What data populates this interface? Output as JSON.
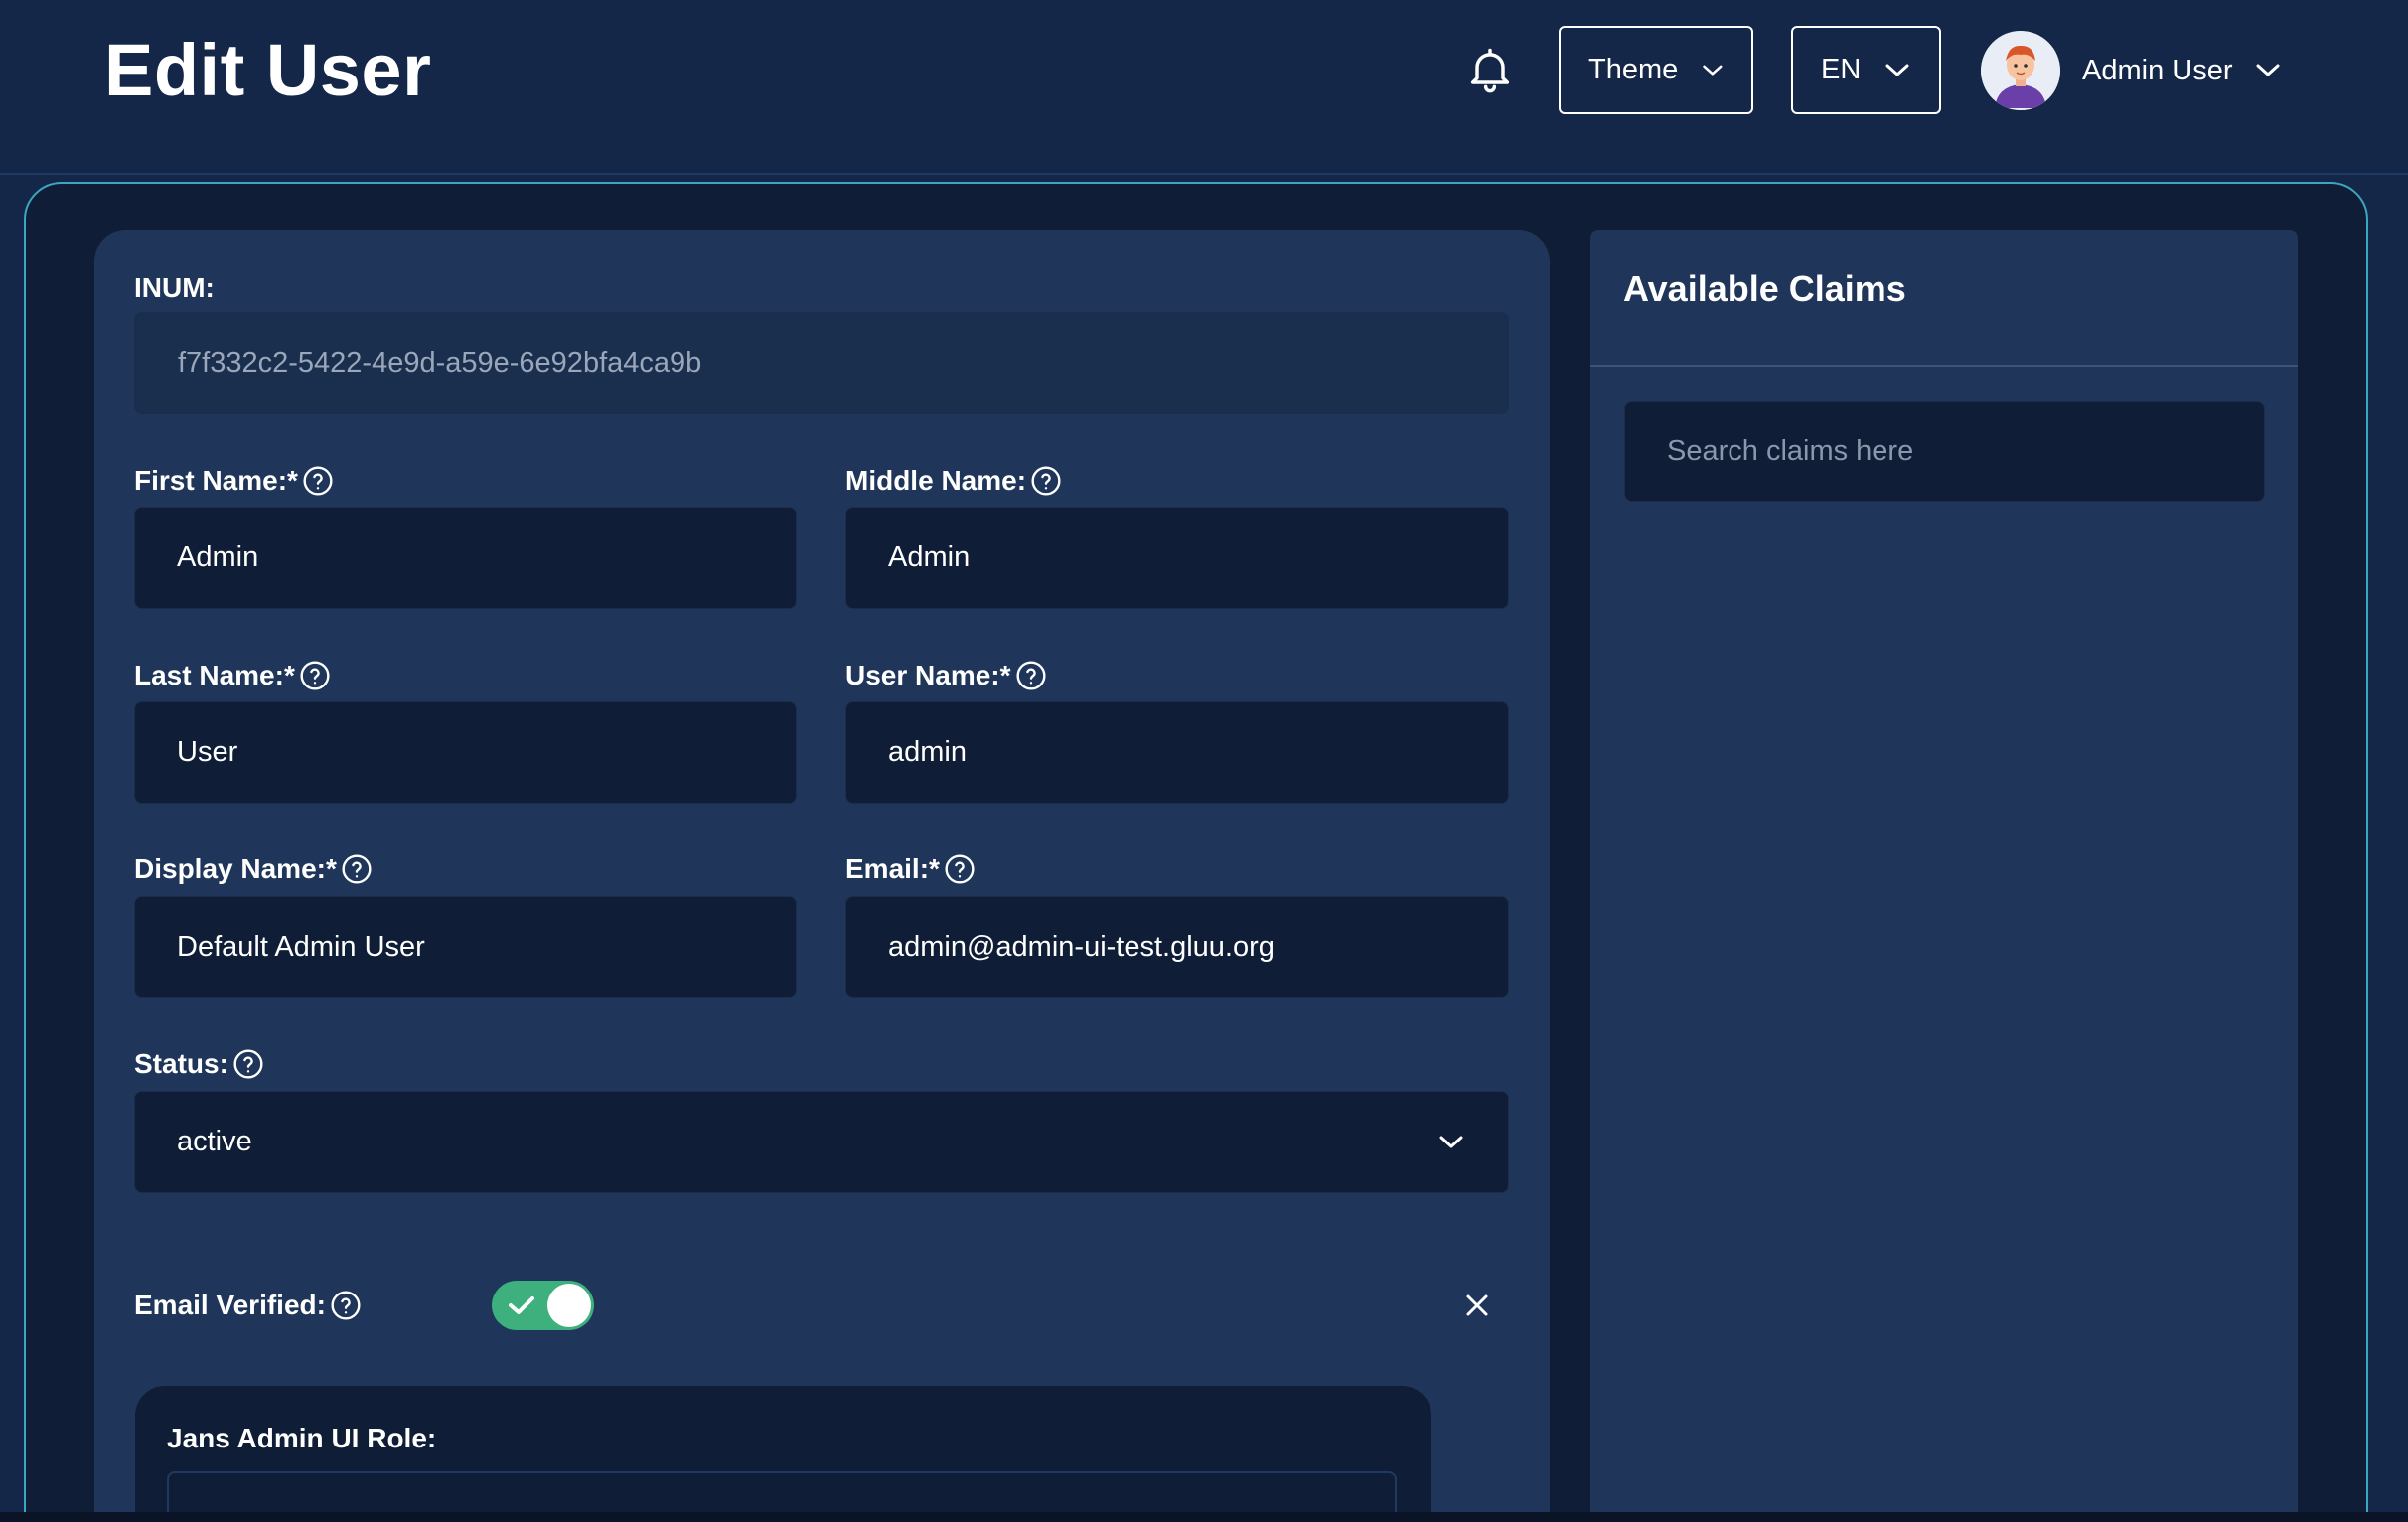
{
  "header": {
    "title": "Edit User",
    "theme_label": "Theme",
    "language_label": "EN",
    "user_name": "Admin User"
  },
  "form": {
    "inum": {
      "label": "INUM:",
      "value": "f7f332c2-5422-4e9d-a59e-6e92bfa4ca9b"
    },
    "first_name": {
      "label": "First Name:*",
      "value": "Admin"
    },
    "middle_name": {
      "label": "Middle Name:",
      "value": "Admin"
    },
    "last_name": {
      "label": "Last Name:*",
      "value": "User"
    },
    "user_name": {
      "label": "User Name:*",
      "value": "admin"
    },
    "display_name": {
      "label": "Display Name:*",
      "value": "Default Admin User"
    },
    "email": {
      "label": "Email:*",
      "value": "admin@admin-ui-test.gluu.org"
    },
    "status": {
      "label": "Status:",
      "value": "active"
    },
    "email_verified": {
      "label": "Email Verified:",
      "checked": true
    },
    "role": {
      "label": "Jans Admin UI Role:"
    }
  },
  "claims": {
    "title": "Available Claims",
    "search_placeholder": "Search claims here"
  },
  "icons": {
    "bell": "bell-icon",
    "chevron": "chevron-down-icon",
    "help": "help-circle-icon",
    "close": "close-icon",
    "check": "check-icon"
  },
  "colors": {
    "background": "#142748",
    "panel": "#1f365a",
    "field": "#0f1e36",
    "accent_border": "#3aa6c2",
    "toggle_on": "#3eb07d"
  }
}
